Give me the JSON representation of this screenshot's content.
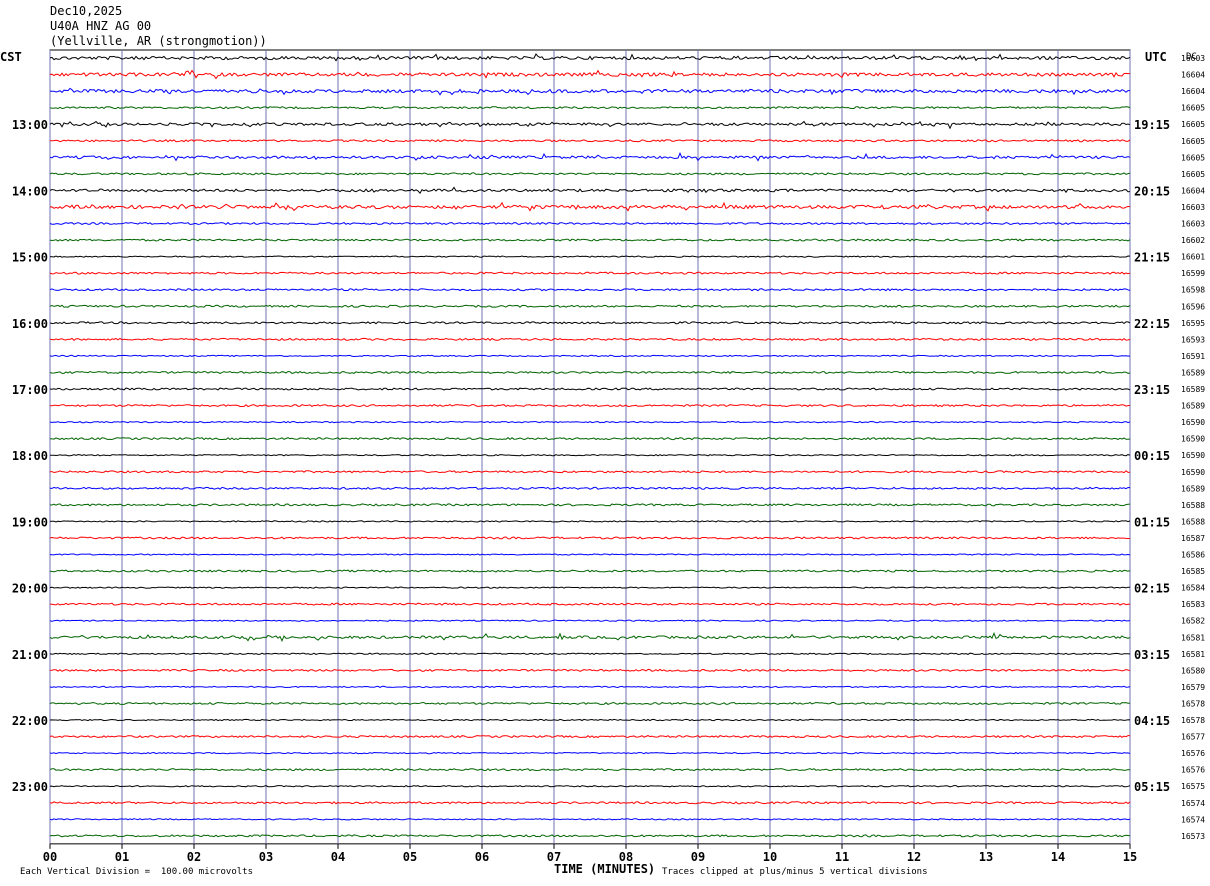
{
  "header": {
    "date": "Dec10,2025",
    "station": "U40A HNZ AG 00",
    "location": "(Yellville, AR (strongmotion))"
  },
  "chart_data": {
    "type": "line",
    "left_axis_label": "CST",
    "right_axis_label": "UTC",
    "dc_label": "DC",
    "xlabel": "TIME (MINUTES)",
    "x_ticks": [
      "00",
      "01",
      "02",
      "03",
      "04",
      "05",
      "06",
      "07",
      "08",
      "09",
      "10",
      "11",
      "12",
      "13",
      "14",
      "15"
    ],
    "xlim": [
      0,
      15
    ],
    "cst_hour_labels": [
      "13:00",
      "14:00",
      "15:00",
      "16:00",
      "17:00",
      "18:00",
      "19:00",
      "20:00",
      "21:00",
      "22:00",
      "23:00"
    ],
    "utc_hour_labels": [
      "19:15",
      "20:15",
      "21:15",
      "22:15",
      "23:15",
      "00:15",
      "01:15",
      "02:15",
      "03:15",
      "04:15",
      "05:15"
    ],
    "dc_values": [
      "16603",
      "16604",
      "16604",
      "16605",
      "16605",
      "16605",
      "16605",
      "16605",
      "16604",
      "16603",
      "16603",
      "16602",
      "16601",
      "16599",
      "16598",
      "16596",
      "16595",
      "16593",
      "16591",
      "16589",
      "16589",
      "16589",
      "16590",
      "16590",
      "16590",
      "16590",
      "16589",
      "16588",
      "16588",
      "16587",
      "16586",
      "16585",
      "16584",
      "16583",
      "16582",
      "16581",
      "16581",
      "16580",
      "16579",
      "16578",
      "16578",
      "16577",
      "16576",
      "16576",
      "16575",
      "16574",
      "16574",
      "16573"
    ],
    "trace_colors": [
      "#000000",
      "#ff0000",
      "#0000ff",
      "#006400"
    ],
    "trace_activity": [
      3,
      3,
      3,
      1,
      2,
      1,
      2,
      1,
      2,
      3,
      1,
      1,
      0,
      1,
      1,
      1,
      1,
      1,
      0,
      1,
      1,
      1,
      0,
      1,
      0,
      1,
      1,
      1,
      0,
      1,
      0,
      1,
      0,
      1,
      0,
      2,
      0,
      1,
      0,
      1,
      0,
      1,
      0,
      1,
      0,
      1,
      0,
      1
    ],
    "clipping_note": "Traces clipped at plus/minus 5 vertical divisions",
    "scale_note": "Each Vertical Division =  100.00 microvolts"
  },
  "colors": {
    "grid_vertical": "#7070b0",
    "background": "#ffffff"
  }
}
